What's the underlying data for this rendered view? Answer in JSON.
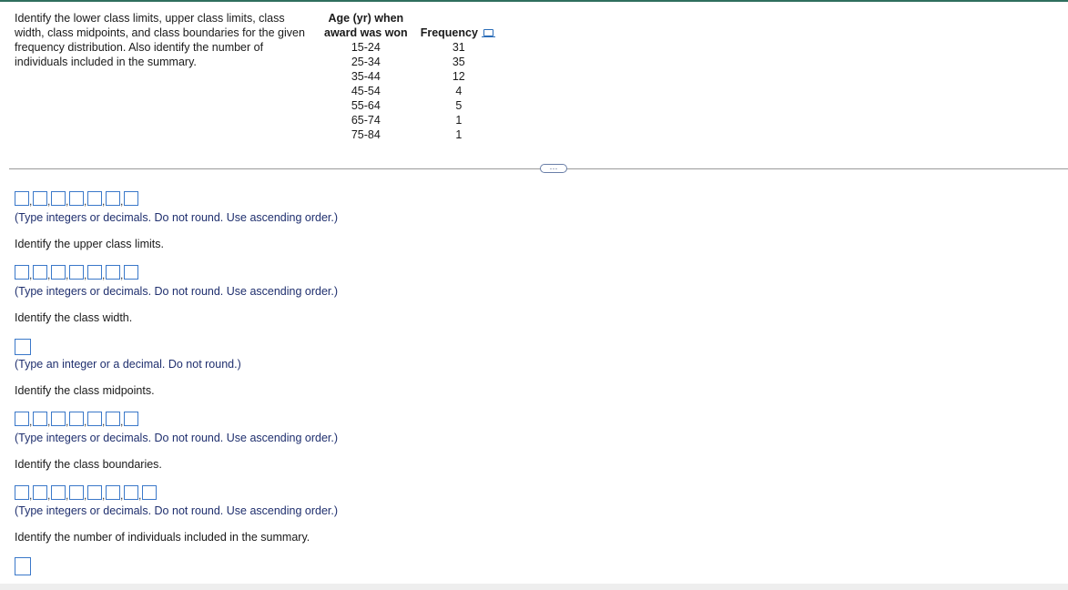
{
  "prompt": "Identify the lower class limits, upper class limits, class width, class midpoints, and class boundaries for the given frequency distribution. Also identify the number of individuals included in the summary.",
  "table": {
    "col1_header_line1": "Age (yr) when",
    "col1_header_line2": "award was won",
    "col2_header": "Frequency",
    "rows": [
      {
        "age": "15-24",
        "freq": "31"
      },
      {
        "age": "25-34",
        "freq": "35"
      },
      {
        "age": "35-44",
        "freq": "12"
      },
      {
        "age": "45-54",
        "freq": "4"
      },
      {
        "age": "55-64",
        "freq": "5"
      },
      {
        "age": "65-74",
        "freq": "1"
      },
      {
        "age": "75-84",
        "freq": "1"
      }
    ]
  },
  "more_button": "···",
  "hints": {
    "ints_dec_asc": "(Type integers or decimals. Do not round. Use ascending order.)",
    "int_or_dec": "(Type an integer or a decimal. Do not round.)"
  },
  "questions": {
    "upper": "Identify the upper class limits.",
    "width": "Identify the class width.",
    "midpoints": "Identify the class midpoints.",
    "boundaries": "Identify the class boundaries.",
    "count": "Identify the number of individuals included in the summary."
  },
  "icons": {
    "copy": "copy-data-icon"
  },
  "colors": {
    "input_border": "#3a78c9",
    "hint_text": "#1f2f6e"
  }
}
